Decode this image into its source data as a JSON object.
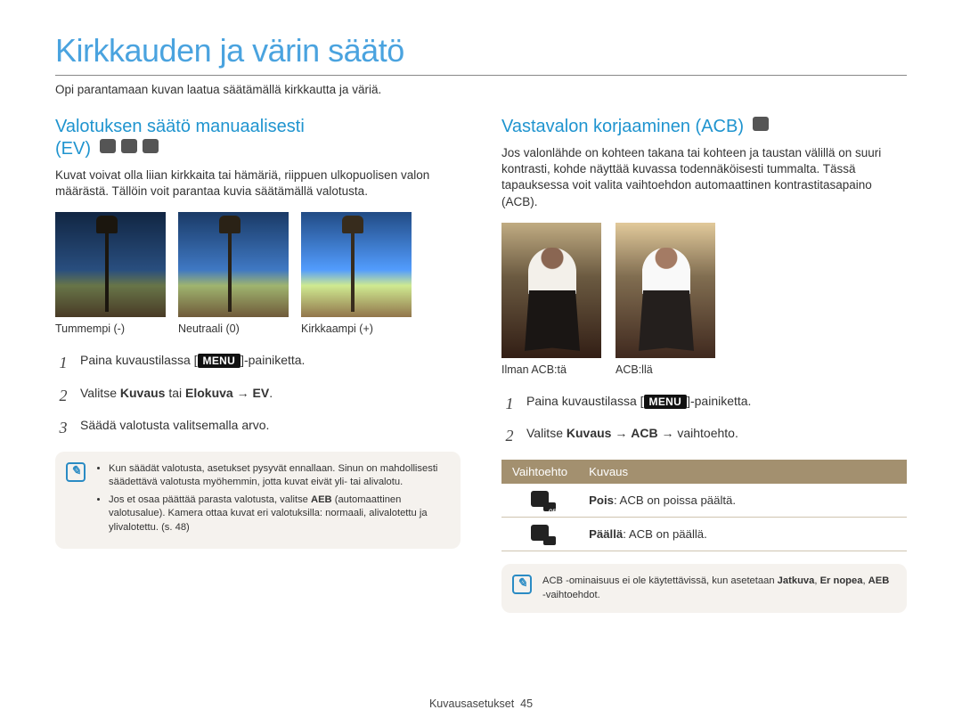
{
  "page": {
    "title": "Kirkkauden ja värin säätö",
    "intro": "Opi parantamaan kuvan laatua säätämällä kirkkautta ja väriä.",
    "footer_section": "Kuvausasetukset",
    "footer_page": "45"
  },
  "left": {
    "heading_line1": "Valotuksen säätö manuaalisesti",
    "heading_line2": "(EV)",
    "icons": [
      "mode-p-icon",
      "mode-dis-icon",
      "mode-movie-icon"
    ],
    "para": "Kuvat voivat olla liian kirkkaita tai hämäriä, riippuen ulkopuolisen valon määrästä. Tällöin voit parantaa kuvia säätämällä valotusta.",
    "samples": [
      {
        "caption": "Tummempi (-)",
        "variant": "dark"
      },
      {
        "caption": "Neutraali (0)",
        "variant": ""
      },
      {
        "caption": "Kirkkaampi (+)",
        "variant": "bright"
      }
    ],
    "steps": {
      "s1_pre": "Paina kuvaustilassa [",
      "s1_btn": "MENU",
      "s1_post": "]-painiketta.",
      "s2_pre": "Valitse ",
      "s2_b1": "Kuvaus",
      "s2_mid": " tai ",
      "s2_b2": "Elokuva",
      "s2_arrow": " → ",
      "s2_b3": "EV",
      "s2_end": ".",
      "s3": "Säädä valotusta valitsemalla arvo."
    },
    "note": {
      "bullet1": "Kun säädät valotusta, asetukset pysyvät ennallaan. Sinun on mahdollisesti säädettävä valotusta myöhemmin, jotta kuvat eivät yli- tai alivalotu.",
      "bullet2_pre": "Jos et osaa päättää parasta valotusta, valitse ",
      "bullet2_bold": "AEB",
      "bullet2_post": " (automaattinen valotusalue). Kamera ottaa kuvat eri valotuksilla: normaali, alivalotettu ja ylivalotettu. (s. 48)"
    }
  },
  "right": {
    "heading": "Vastavalon korjaaminen (ACB)",
    "icons": [
      "mode-p-icon"
    ],
    "para": "Jos valonlähde on kohteen takana tai kohteen ja taustan välillä on suuri kontrasti, kohde näyttää kuvassa todennäköisesti tummalta. Tässä tapauksessa voit valita vaihtoehdon automaattinen kontrastitasapaino (ACB).",
    "samples": [
      {
        "caption": "Ilman ACB:tä",
        "variant": ""
      },
      {
        "caption": "ACB:llä",
        "variant": "lighter"
      }
    ],
    "steps": {
      "s1_pre": "Paina kuvaustilassa [",
      "s1_btn": "MENU",
      "s1_post": "]-painiketta.",
      "s2_pre": "Valitse ",
      "s2_b1": "Kuvaus",
      "s2_arrow1": " → ",
      "s2_b2": "ACB",
      "s2_arrow2": " → vaihtoehto."
    },
    "table": {
      "head_option": "Vaihtoehto",
      "head_desc": "Kuvaus",
      "rows": [
        {
          "icon": "acb-off-icon",
          "label_bold": "Pois",
          "label_rest": ": ACB on poissa päältä."
        },
        {
          "icon": "acb-on-icon",
          "label_bold": "Päällä",
          "label_rest": ": ACB on päällä."
        }
      ]
    },
    "note": {
      "text_pre": "ACB -ominaisuus ei ole käytettävissä, kun asetetaan ",
      "b1": "Jatkuva",
      "sep": ", ",
      "b2": "Er nopea",
      "sep2": ", ",
      "b3": "AEB",
      "text_post": " -vaihtoehdot."
    }
  }
}
